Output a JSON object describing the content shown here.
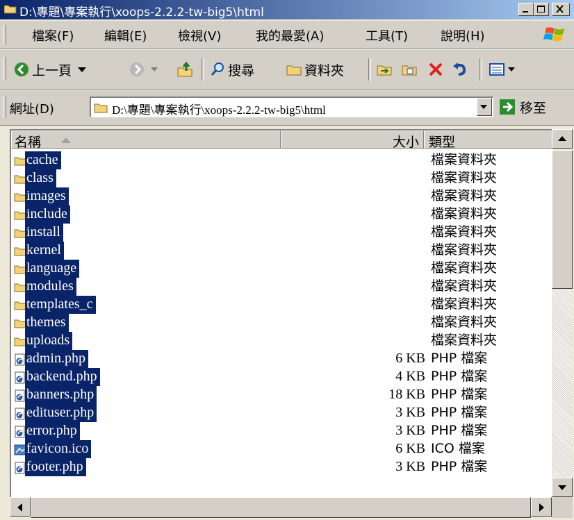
{
  "window": {
    "title": "D:\\專題\\專案執行\\xoops-2.2.2-tw-big5\\html",
    "minimize_label": "minimize",
    "maximize_label": "maximize",
    "close_label": "close"
  },
  "menu": [
    {
      "label": "檔案(F)"
    },
    {
      "label": "編輯(E)"
    },
    {
      "label": "檢視(V)"
    },
    {
      "label": "我的最愛(A)"
    },
    {
      "label": "工具(T)"
    },
    {
      "label": "說明(H)"
    }
  ],
  "toolbar": {
    "back_label": "上一頁",
    "search_label": "搜尋",
    "folders_label": "資料夾"
  },
  "address": {
    "label": "網址(D)",
    "value": "D:\\專題\\專案執行\\xoops-2.2.2-tw-big5\\html",
    "go_label": "移至"
  },
  "columns": {
    "name": "名稱",
    "size": "大小",
    "type": "類型"
  },
  "files": [
    {
      "name": "cache",
      "size": "",
      "type": "檔案資料夾",
      "icon": "folder-icon"
    },
    {
      "name": "class",
      "size": "",
      "type": "檔案資料夾",
      "icon": "folder-icon"
    },
    {
      "name": "images",
      "size": "",
      "type": "檔案資料夾",
      "icon": "folder-icon"
    },
    {
      "name": "include",
      "size": "",
      "type": "檔案資料夾",
      "icon": "folder-icon"
    },
    {
      "name": "install",
      "size": "",
      "type": "檔案資料夾",
      "icon": "folder-icon"
    },
    {
      "name": "kernel",
      "size": "",
      "type": "檔案資料夾",
      "icon": "folder-icon"
    },
    {
      "name": "language",
      "size": "",
      "type": "檔案資料夾",
      "icon": "folder-icon"
    },
    {
      "name": "modules",
      "size": "",
      "type": "檔案資料夾",
      "icon": "folder-icon"
    },
    {
      "name": "templates_c",
      "size": "",
      "type": "檔案資料夾",
      "icon": "folder-icon"
    },
    {
      "name": "themes",
      "size": "",
      "type": "檔案資料夾",
      "icon": "folder-icon"
    },
    {
      "name": "uploads",
      "size": "",
      "type": "檔案資料夾",
      "icon": "folder-icon"
    },
    {
      "name": "admin.php",
      "size": "6 KB",
      "type": "PHP 檔案",
      "icon": "php-file-icon"
    },
    {
      "name": "backend.php",
      "size": "4 KB",
      "type": "PHP 檔案",
      "icon": "php-file-icon"
    },
    {
      "name": "banners.php",
      "size": "18 KB",
      "type": "PHP 檔案",
      "icon": "php-file-icon"
    },
    {
      "name": "edituser.php",
      "size": "3 KB",
      "type": "PHP 檔案",
      "icon": "php-file-icon"
    },
    {
      "name": "error.php",
      "size": "3 KB",
      "type": "PHP 檔案",
      "icon": "php-file-icon"
    },
    {
      "name": "favicon.ico",
      "size": "6 KB",
      "type": "ICO 檔案",
      "icon": "ico-file-icon"
    },
    {
      "name": "footer.php",
      "size": "3 KB",
      "type": "PHP 檔案",
      "icon": "php-file-icon"
    }
  ],
  "colors": {
    "selection": "#0a246a",
    "titlebar_start": "#0a246a",
    "titlebar_end": "#a6caf0",
    "face": "#d4d0c8"
  }
}
